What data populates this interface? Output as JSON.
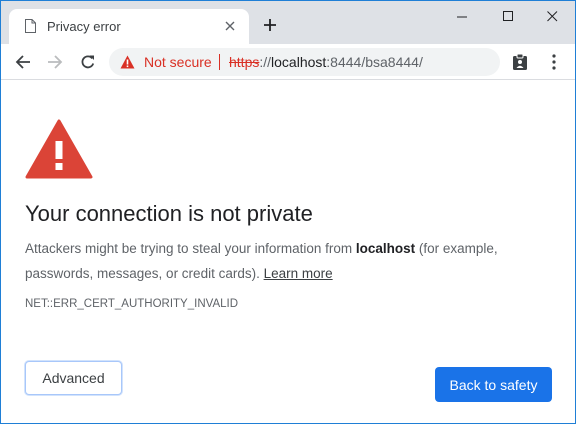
{
  "browser": {
    "tab": {
      "title": "Privacy error",
      "favicon": "document-icon"
    },
    "window_controls": {
      "minimize": "minimize-icon",
      "maximize": "maximize-icon",
      "close": "close-icon"
    },
    "omnibox": {
      "security_label": "Not secure",
      "url_scheme": "https",
      "url_separator": "://",
      "url_host": "localhost",
      "url_rest": ":8444/bsa8444/"
    }
  },
  "page": {
    "heading": "Your connection is not private",
    "desc_prefix": "Attackers might be trying to steal your information from ",
    "desc_host": "localhost",
    "desc_suffix": " (for example, passwords, messages, or credit cards). ",
    "learn_more": "Learn more",
    "error_code": "NET::ERR_CERT_AUTHORITY_INVALID",
    "advanced_label": "Advanced",
    "safety_label": "Back to safety"
  },
  "colors": {
    "warning_red": "#d93025",
    "big_warning_red": "#db4437",
    "primary_blue": "#1a73e8",
    "tabstrip_bg": "#dee1e6"
  }
}
